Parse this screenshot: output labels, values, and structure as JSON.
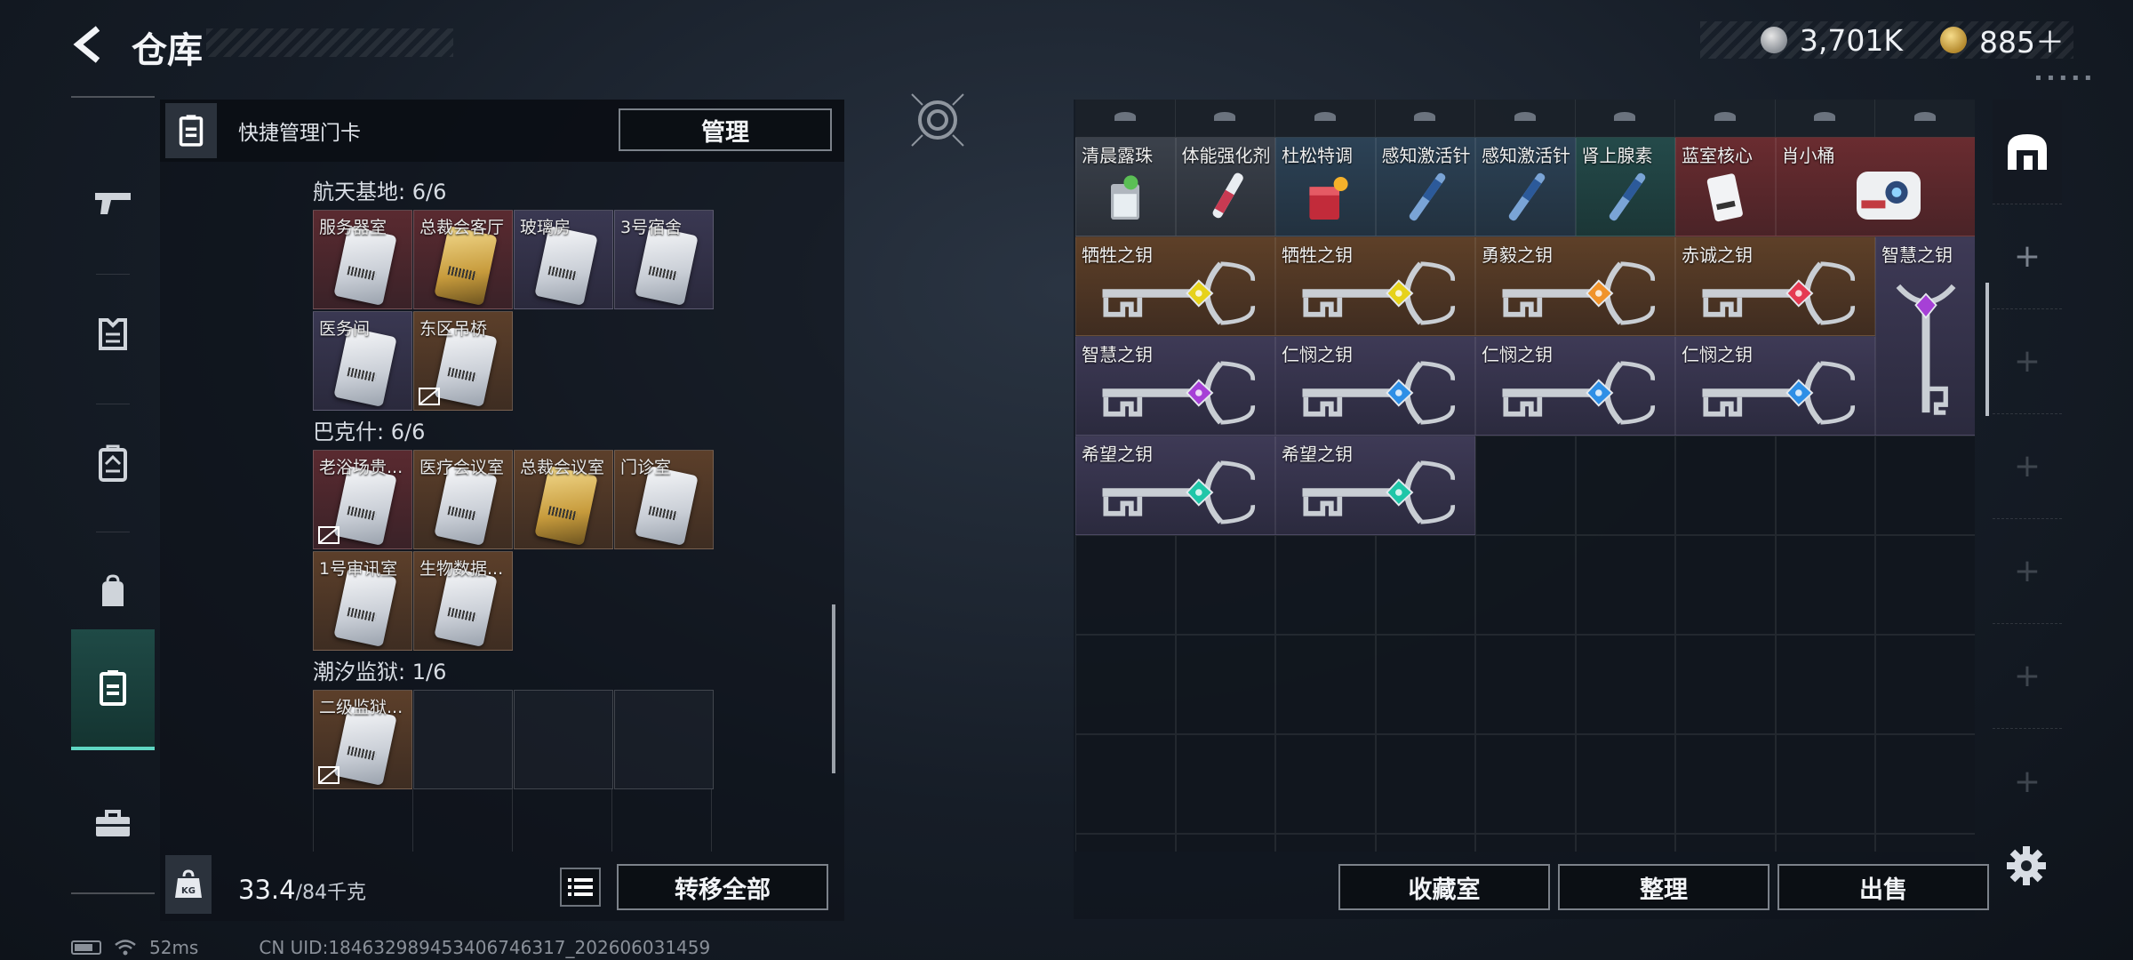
{
  "header": {
    "title": "仓库"
  },
  "currency": [
    {
      "icon": "silver-coin-icon",
      "value": "3,701K"
    },
    {
      "icon": "gold-coin-icon",
      "value": "885＋"
    }
  ],
  "quick": {
    "label": "快捷管理门卡",
    "manage": "管理"
  },
  "sections": [
    {
      "title": "航天基地: 6/6",
      "rows": [
        [
          {
            "name": "服务器室",
            "bg": "red",
            "card": "silver"
          },
          {
            "name": "总裁会客厅",
            "bg": "red",
            "card": "gold"
          },
          {
            "name": "玻璃房",
            "bg": "purple",
            "card": "silver"
          },
          {
            "name": "3号宿舍",
            "bg": "purple",
            "card": "silver"
          }
        ],
        [
          {
            "name": "医务间",
            "bg": "purple",
            "card": "silver"
          },
          {
            "name": "东区吊桥",
            "bg": "orange",
            "card": "silver",
            "tag": true
          }
        ]
      ]
    },
    {
      "title": "巴克什: 6/6",
      "rows": [
        [
          {
            "name": "老浴场贵...",
            "bg": "red",
            "card": "silver",
            "tag": true
          },
          {
            "name": "医疗会议室",
            "bg": "orange",
            "card": "silver"
          },
          {
            "name": "总裁会议室",
            "bg": "orange",
            "card": "gold"
          },
          {
            "name": "门诊室",
            "bg": "orange",
            "card": "silver"
          }
        ],
        [
          {
            "name": "1号审讯室",
            "bg": "orange",
            "card": "silver"
          },
          {
            "name": "生物数据...",
            "bg": "orange",
            "card": "silver"
          }
        ]
      ]
    },
    {
      "title": "潮汐监狱: 1/6",
      "rows": [
        [
          {
            "name": "二级监狱...",
            "bg": "orange",
            "card": "silver",
            "tag": true
          },
          {
            "name": "",
            "bg": "empty"
          },
          {
            "name": "",
            "bg": "empty"
          },
          {
            "name": "",
            "bg": "empty"
          }
        ]
      ]
    }
  ],
  "footer": {
    "weight": "33.4",
    "weight_max": "/84千克",
    "transfer": "转移全部"
  },
  "status": {
    "ping": "52ms",
    "uid": "CN UID:18463298945340674631​7_202606031459"
  },
  "items_row1": [
    {
      "name": "清晨露珠",
      "bg": "gray",
      "icon": "glass-icon"
    },
    {
      "name": "体能强化剂",
      "bg": "gray",
      "icon": "injector-icon"
    },
    {
      "name": "杜松特调",
      "bg": "blue",
      "icon": "cocktail-icon"
    },
    {
      "name": "感知激活针",
      "bg": "blue",
      "icon": "syringe-icon"
    },
    {
      "name": "感知激活针",
      "bg": "blue",
      "icon": "syringe-icon"
    },
    {
      "name": "肾上腺素",
      "bg": "teal",
      "icon": "syringe-icon"
    },
    {
      "name": "蓝室核心",
      "bg": "red",
      "icon": "keycard-icon"
    },
    {
      "name": "肖小桶",
      "bg": "red",
      "icon": "robot-icon"
    }
  ],
  "keys": [
    {
      "name": "牺牲之钥",
      "bg": "orange",
      "gem": "#e6d21a"
    },
    {
      "name": "牺牲之钥",
      "bg": "orange",
      "gem": "#e6d21a"
    },
    {
      "name": "勇毅之钥",
      "bg": "orange",
      "gem": "#f0932a"
    },
    {
      "name": "赤诚之钥",
      "bg": "orange",
      "gem": "#e53a52"
    },
    {
      "name": "智慧之钥",
      "bg": "purple",
      "gem": "#a640d6"
    },
    {
      "name": "智慧之钥",
      "bg": "purple",
      "gem": "#a640d6"
    },
    {
      "name": "仁悯之钥",
      "bg": "purple",
      "gem": "#2e8fe6"
    },
    {
      "name": "仁悯之钥",
      "bg": "purple",
      "gem": "#2e8fe6"
    },
    {
      "name": "仁悯之钥",
      "bg": "purple",
      "gem": "#2e8fe6"
    },
    {
      "name": "希望之钥",
      "bg": "purple",
      "gem": "#1fc6a8"
    },
    {
      "name": "希望之钥",
      "bg": "purple",
      "gem": "#1fc6a8"
    }
  ],
  "buttons": {
    "collection": "收藏室",
    "sort": "整理",
    "sell": "出售"
  }
}
